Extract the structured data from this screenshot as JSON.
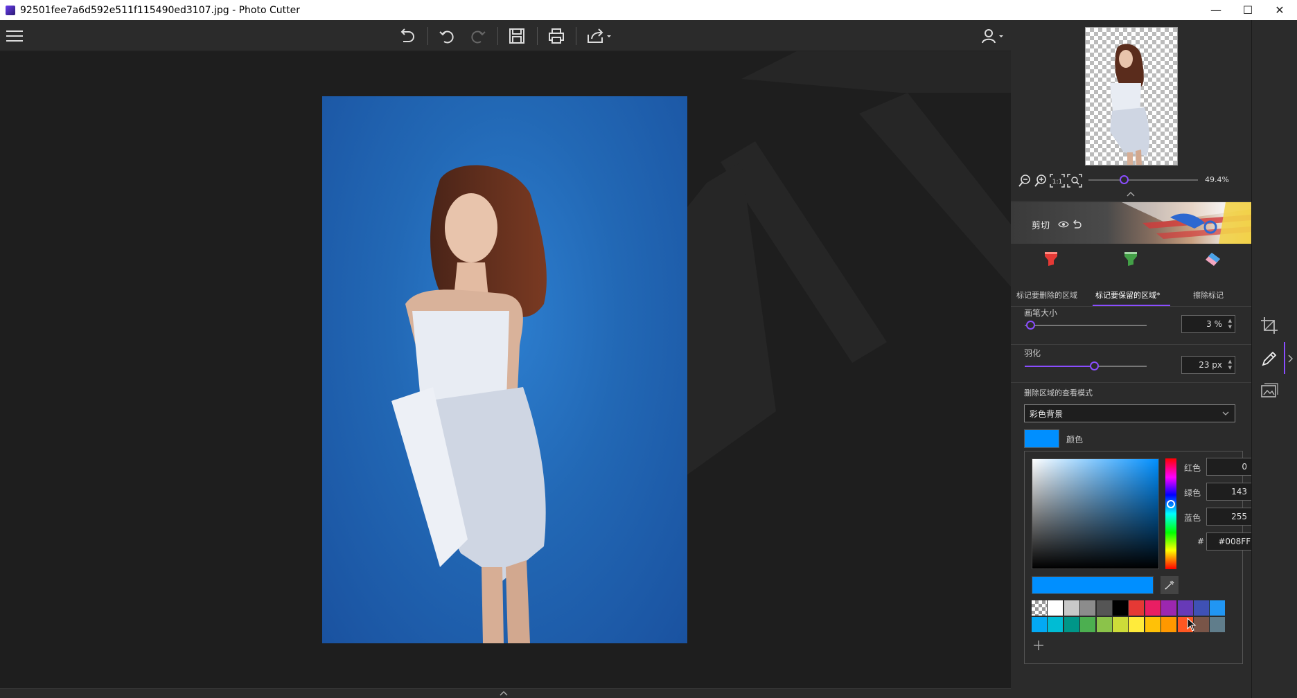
{
  "window": {
    "title": "92501fee7a6d592e511f115490ed3107.jpg - Photo Cutter"
  },
  "zoom": {
    "value": "49.4%",
    "position": 0.3
  },
  "cut_section": {
    "label": "剪切"
  },
  "tools": [
    {
      "label": "标记要删除的区域",
      "active": false
    },
    {
      "label": "标记要保留的区域*",
      "active": true
    },
    {
      "label": "擦除标记",
      "active": false
    }
  ],
  "brush": {
    "label": "画笔大小",
    "value": "3 %",
    "position": 0.03
  },
  "feather": {
    "label": "羽化",
    "value": "23 px",
    "position": 0.46
  },
  "view_mode": {
    "label": "删除区域的查看模式",
    "selected": "彩色背景"
  },
  "color": {
    "label": "颜色",
    "current": "#008FFF",
    "red_label": "红色",
    "red": "0",
    "green_label": "绿色",
    "green": "143",
    "blue_label": "蓝色",
    "blue": "255",
    "hex_label": "#",
    "hex": "#008FFF"
  },
  "swatches_row1": [
    "#ffffff",
    "#c8c8c8",
    "#8c8c8c",
    "#555555",
    "#000000",
    "#e53935",
    "#e91e63",
    "#9c27b0",
    "#673ab7",
    "#3f51b5",
    "#2196f3"
  ],
  "swatches_row2": [
    "#03a9f4",
    "#00bcd4",
    "#009688",
    "#4caf50",
    "#8bc34a",
    "#cddc39",
    "#ffeb3b",
    "#ffc107",
    "#ff9800",
    "#ff5722",
    "#795548",
    "#607d8b"
  ]
}
